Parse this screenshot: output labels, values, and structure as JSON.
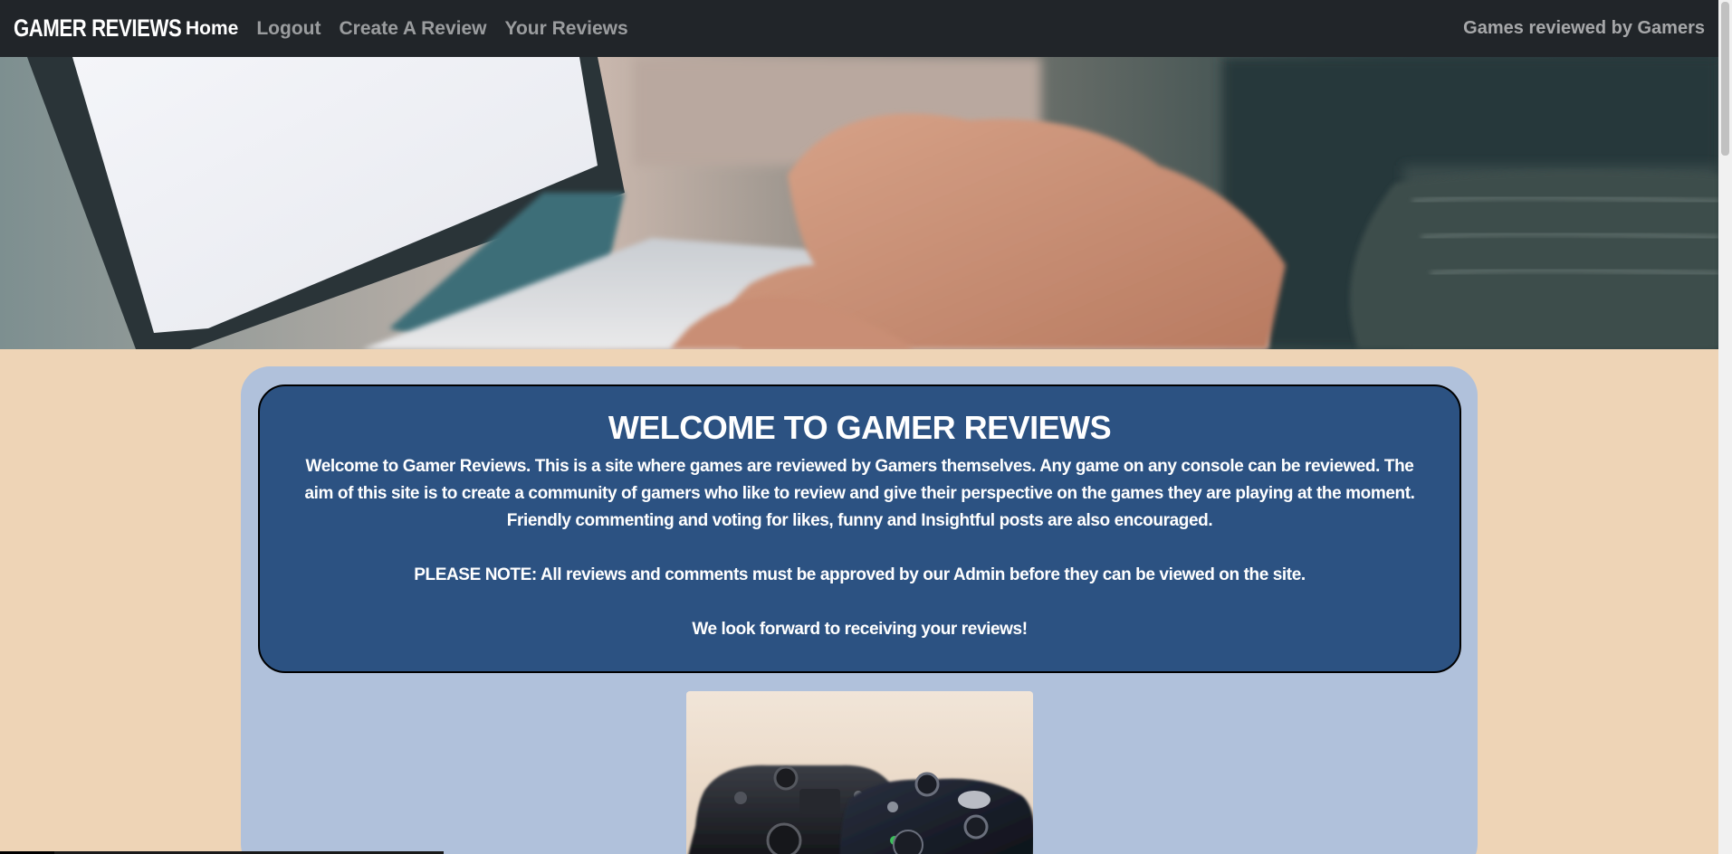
{
  "navbar": {
    "brand": "GAMER REVIEWS",
    "links": [
      {
        "label": "Home",
        "active": true
      },
      {
        "label": "Logout",
        "active": false
      },
      {
        "label": "Create A Review",
        "active": false
      },
      {
        "label": "Your Reviews",
        "active": false
      }
    ],
    "tagline": "Games reviewed by Gamers"
  },
  "welcome": {
    "title": "WELCOME TO GAMER REVIEWS",
    "intro": "Welcome to Gamer Reviews. This is a site where games are reviewed by Gamers themselves. Any game on any console can be reviewed. The aim of this site is to create a community of gamers who like to review and give their perspective on the games they are playing at the moment. Friendly commenting and voting for likes, funny and Insightful posts are also encouraged.",
    "note": "PLEASE NOTE: All reviews and comments must be approved by our Admin before they can be viewed on the site.",
    "closing": "We look forward to receiving your reviews!"
  },
  "colors": {
    "navbar_bg": "#212529",
    "page_bg": "#eed4b6",
    "outer_card_bg": "#b0c1db",
    "welcome_box_bg": "#2c5282"
  }
}
